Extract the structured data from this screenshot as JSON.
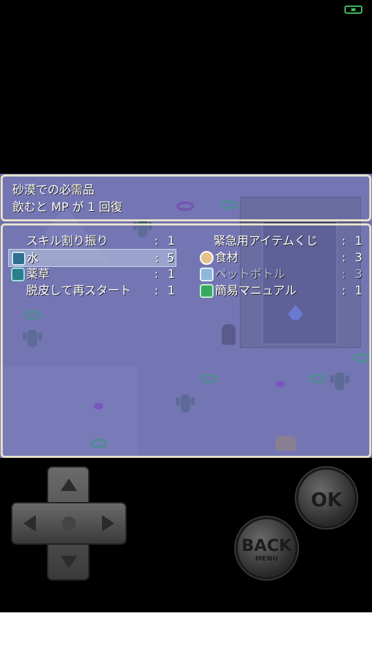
{
  "help": {
    "line1": "砂漠での必需品",
    "line2": "飲むと MP が 1 回復"
  },
  "items": [
    {
      "name": "スキル割り振り",
      "count": "1",
      "icon": "none",
      "dim": false
    },
    {
      "name": "緊急用アイテムくじ",
      "count": "1",
      "icon": "none",
      "dim": false
    },
    {
      "name": "水",
      "count": "5",
      "icon": "water-icon",
      "dim": false,
      "selected": true
    },
    {
      "name": "食材",
      "count": "3",
      "icon": "food-icon",
      "dim": false
    },
    {
      "name": "薬草",
      "count": "1",
      "icon": "herb-icon",
      "dim": false
    },
    {
      "name": "ペットボトル",
      "count": "3",
      "icon": "bottle-icon",
      "dim": true
    },
    {
      "name": "脱皮して再スタート",
      "count": "1",
      "icon": "none",
      "dim": false
    },
    {
      "name": "簡易マニュアル",
      "count": "1",
      "icon": "manual-icon",
      "dim": false
    }
  ],
  "colon": ":",
  "controls": {
    "ok_label": "OK",
    "back_label": "BACK",
    "back_sub_label": "MENU"
  }
}
